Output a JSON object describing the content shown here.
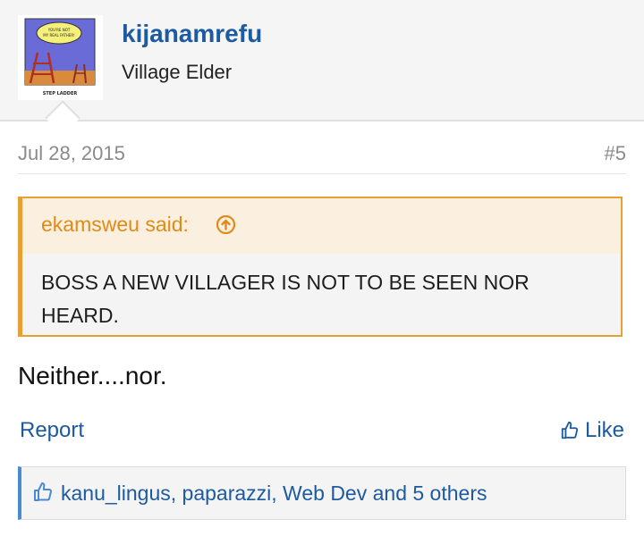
{
  "post": {
    "author": {
      "name": "kijanamrefu",
      "title": "Village Elder",
      "avatar": {
        "speech": "YOU'RE NOT MY REAL FATHER!",
        "caption": "STEP LADDER"
      }
    },
    "date": "Jul 28, 2015",
    "number": "#5",
    "quote": {
      "author": "ekamsweu said:",
      "text": "BOSS A NEW VILLAGER IS NOT TO BE SEEN NOR HEARD."
    },
    "message": "Neither....nor.",
    "actions": {
      "report": "Report",
      "like": "Like"
    },
    "likes": "kanu_lingus, paparazzi, Web Dev and 5 others"
  },
  "colors": {
    "link": "#1d5aa0",
    "quote_accent": "#e8a033",
    "likes_accent": "#4a8ad0"
  }
}
